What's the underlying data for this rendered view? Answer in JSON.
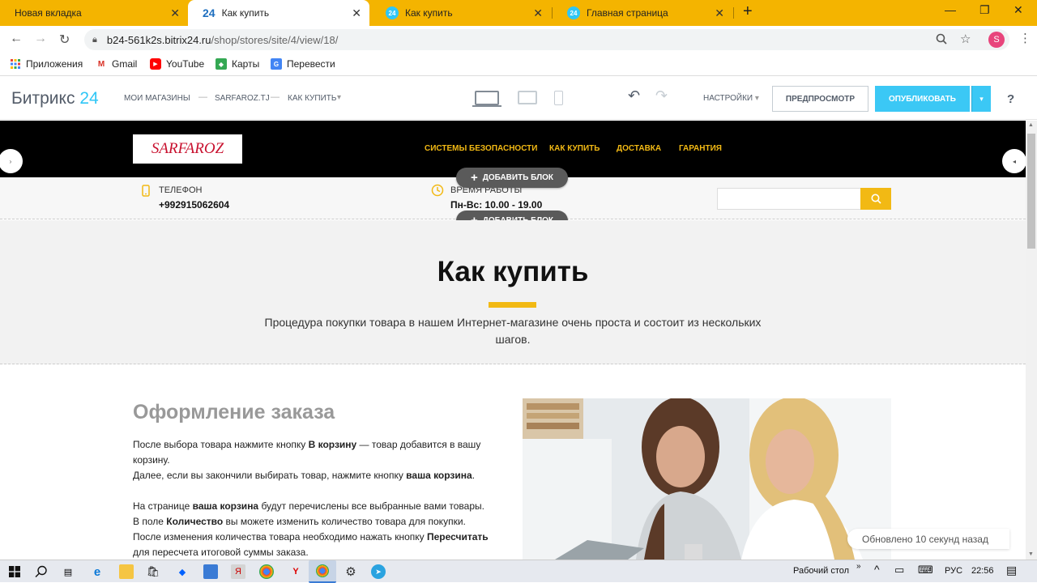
{
  "browser": {
    "tabs": [
      {
        "title": "Новая вкладка",
        "icon": "none"
      },
      {
        "title": "Как купить",
        "icon": "bitrix24-favicon"
      },
      {
        "title": "Как купить",
        "icon": "bitrix24-circle-favicon"
      },
      {
        "title": "Главная страница",
        "icon": "bitrix24-circle-favicon"
      }
    ],
    "url_host": "b24-561k2s.bitrix24.ru",
    "url_path": "/shop/stores/site/4/view/18/",
    "profile_initial": "S",
    "bookmarks": [
      "Приложения",
      "Gmail",
      "YouTube",
      "Карты",
      "Перевести"
    ]
  },
  "b24": {
    "logo_text": "Битрикс",
    "logo_num": "24",
    "breadcrumbs": [
      "МОИ МАГАЗИНЫ",
      "SARFAROZ.TJ",
      "КАК КУПИТЬ"
    ],
    "settings_label": "НАСТРОЙКИ",
    "preview_label": "ПРЕДПРОСМОТР",
    "publish_label": "ОПУБЛИКОВАТЬ",
    "help_label": "?"
  },
  "site": {
    "logo_text": "SARFAROZ",
    "menu": [
      "СИСТЕМЫ БЕЗОПАСНОСТИ",
      "КАК КУПИТЬ",
      "ДОСТАВКА",
      "ГАРАНТИЯ"
    ],
    "phone_label": "ТЕЛЕФОН",
    "phone_value": "+992915062604",
    "hours_label": "ВРЕМЯ РАБОТЫ",
    "hours_value": "Пн-Вс: 10.00 - 19.00",
    "add_block_label": "ДОБАВИТЬ БЛОК",
    "page_title": "Как купить",
    "page_desc": "Процедура покупки товара в нашем Интернет-магазине очень проста и состоит из нескольких шагов.",
    "section_title": "Оформление заказа",
    "section_lines": [
      [
        "После выбора товара нажмите кнопку ",
        "В корзину",
        " — товар добавится в вашу корзину."
      ],
      [
        "Далее, если вы закончили выбирать товар, нажмите кнопку ",
        "ваша корзина",
        "."
      ],
      [
        "На странице ",
        "ваша корзина",
        " будут перечислены все выбранные вами товары."
      ],
      [
        "В поле ",
        "Количество",
        " вы можете изменить количество товара для покупки."
      ],
      [
        "После изменения количества товара необходимо нажать кнопку ",
        "Пересчитать",
        " для пересчета итоговой суммы заказа."
      ]
    ],
    "toast": "Обновлено 10 секунд назад"
  },
  "taskbar": {
    "desktop_label": "Рабочий стол",
    "lang": "РУС",
    "time": "22:56"
  },
  "colors": {
    "accent_yellow": "#f2b914",
    "bitrix_blue": "#3bc8f5",
    "tabstrip": "#f4b400"
  }
}
